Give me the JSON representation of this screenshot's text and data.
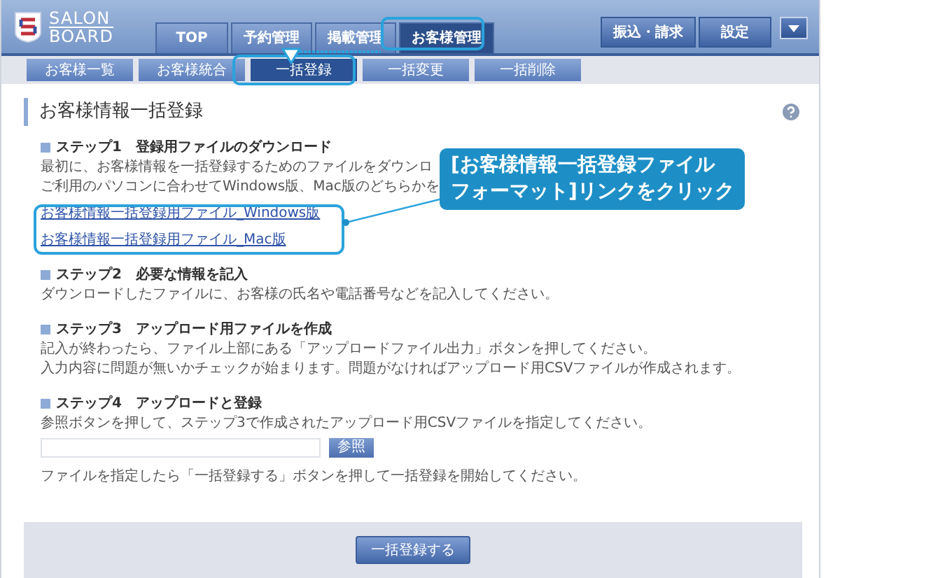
{
  "logo": {
    "line1": "SALON",
    "line2": "BOARD"
  },
  "main_nav": [
    {
      "label": "TOP",
      "selected": false
    },
    {
      "label": "予約管理",
      "selected": false
    },
    {
      "label": "掲載管理",
      "selected": false
    },
    {
      "label": "お客様管理",
      "selected": true
    }
  ],
  "right_nav": [
    "振込・請求",
    "設定"
  ],
  "sub_nav": [
    {
      "label": "お客様一覧",
      "selected": false
    },
    {
      "label": "お客様統合",
      "selected": false
    },
    {
      "label": "一括登録",
      "selected": true
    },
    {
      "label": "一括変更",
      "selected": false
    },
    {
      "label": "一括削除",
      "selected": false
    }
  ],
  "page_title": "お客様情報一括登録",
  "steps": [
    {
      "heading": "ステップ1　登録用ファイルのダウンロード",
      "lines": [
        "最初に、お客様情報を一括登録するためのファイルをダウンロ",
        "ご利用のパソコンに合わせてWindows版、Mac版のどちらかを"
      ],
      "links": [
        "お客様情報一括登録用ファイル_Windows版",
        "お客様情報一括登録用ファイル_Mac版"
      ]
    },
    {
      "heading": "ステップ2　必要な情報を記入",
      "lines": [
        "ダウンロードしたファイルに、お客様の氏名や電話番号などを記入してください。"
      ]
    },
    {
      "heading": "ステップ3　アップロード用ファイルを作成",
      "lines": [
        "記入が終わったら、ファイル上部にある「アップロードファイル出力」ボタンを押してください。",
        "入力内容に問題が無いかチェックが始まります。問題がなければアップロード用CSVファイルが作成されます。"
      ]
    },
    {
      "heading": "ステップ4　アップロードと登録",
      "lines": [
        "参照ボタンを押して、ステップ3で作成されたアップロード用CSVファイルを指定してください。"
      ],
      "browse_button": "参照",
      "note": "ファイルを指定したら「一括登録する」ボタンを押して一括登録を開始してください。"
    }
  ],
  "submit_button": "一括登録する",
  "callout": [
    "[お客様情報一括登録ファイル",
    "フォーマット]リンクをクリック"
  ]
}
